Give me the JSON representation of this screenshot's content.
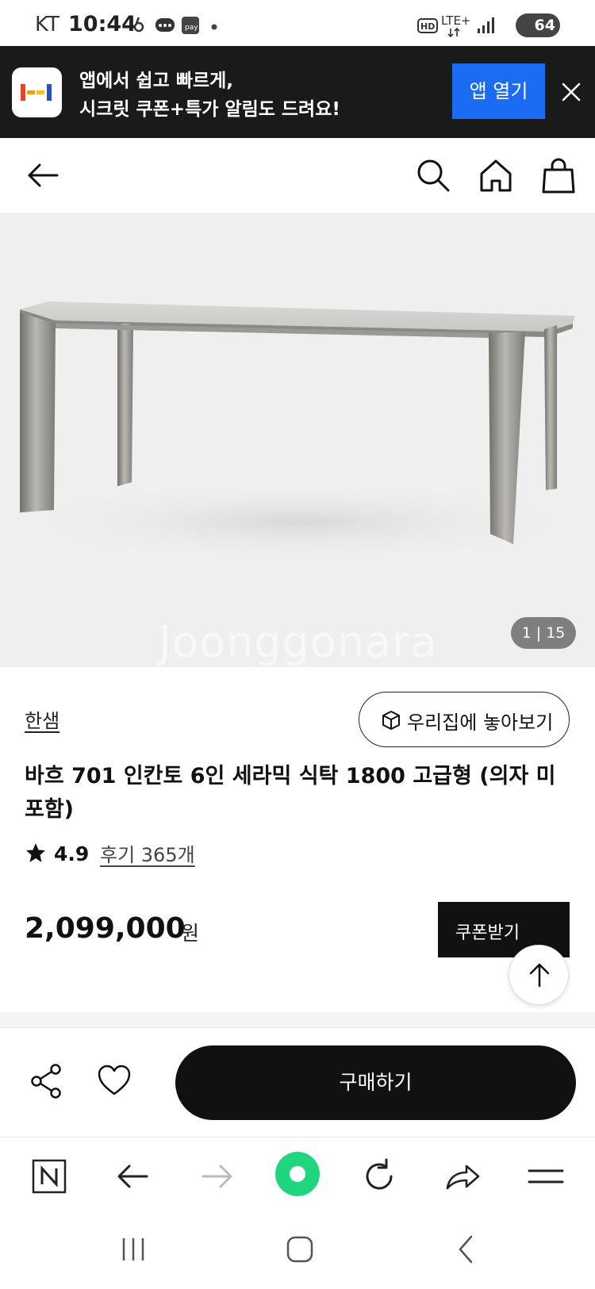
{
  "status_bar": {
    "carrier": "KT",
    "time": "10:44",
    "battery": "64"
  },
  "app_banner": {
    "line1": "앱에서 쉽고 빠르게,",
    "line2": "시크릿 쿠폰+특가 알림도 드려요!",
    "open_button": "앱 열기"
  },
  "product": {
    "image_counter": "1 | 15",
    "watermark": "Joonggonara",
    "brand": "한샘",
    "view_in_home_label": "우리집에 놓아보기",
    "title": "바흐 701 인칸토 6인 세라믹 식탁 1800 고급형 (의자 미포함)",
    "rating": "4.9",
    "reviews": "후기 365개",
    "price": "2,099,000",
    "price_unit": "원",
    "coupon_button": "쿠폰받기"
  },
  "bottom_bar": {
    "buy_button": "구매하기"
  },
  "colors": {
    "banner_bg": "#1a1a1a",
    "open_button": "#1b6cf2",
    "buy_button": "#111111",
    "browser_accent": "#1fd67f"
  }
}
